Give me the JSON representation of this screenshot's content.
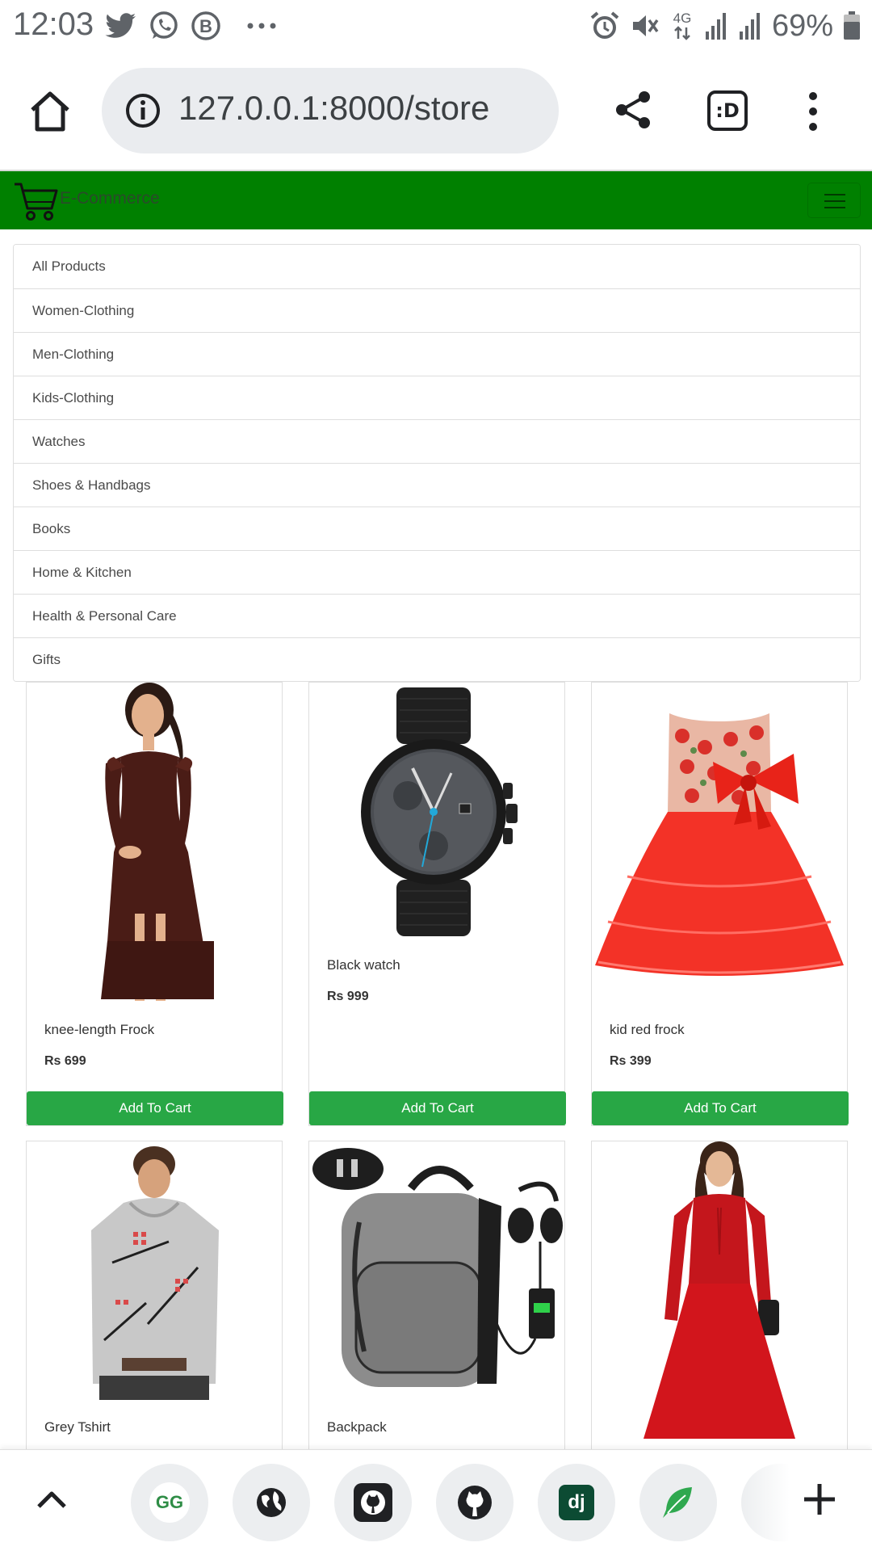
{
  "status_bar": {
    "time": "12:03",
    "battery": "69%",
    "network": "4G",
    "left_icons": [
      "twitter-icon",
      "whatsapp-icon",
      "b-circle-icon",
      "more-dots-icon"
    ],
    "right_icons": [
      "alarm-icon",
      "mute-icon",
      "signal-icon",
      "battery-icon"
    ]
  },
  "browser": {
    "url": "127.0.0.1:8000/store",
    "tab_switcher_label": ":D"
  },
  "site_nav": {
    "brand": "E-Commerce"
  },
  "categories": [
    "All Products",
    "Women-Clothing",
    "Men-Clothing",
    "Kids-Clothing",
    "Watches",
    "Shoes & Handbags",
    "Books",
    "Home & Kitchen",
    "Health & Personal Care",
    "Gifts"
  ],
  "products": [
    {
      "name": "knee-length Frock",
      "price": "Rs 699",
      "button": "Add To Cart"
    },
    {
      "name": "Black watch",
      "price": "Rs 999",
      "button": "Add To Cart"
    },
    {
      "name": "kid red frock",
      "price": "Rs 399",
      "button": "Add To Cart"
    },
    {
      "name": "Grey Tshirt"
    },
    {
      "name": "Backpack"
    },
    {
      "name": ""
    }
  ],
  "bottom_bar": {
    "shortcut_labels": [
      "GG",
      "",
      "",
      "",
      "dj",
      "",
      ""
    ],
    "shortcut_icons": [
      "geeksforgeeks-icon",
      "globe-icon",
      "github-icon",
      "github-icon",
      "django-icon",
      "leaf-icon",
      "partial-shortcut-icon"
    ]
  },
  "colors": {
    "navbar": "#008000",
    "button": "#28a745",
    "url_pill": "#eaecef"
  }
}
